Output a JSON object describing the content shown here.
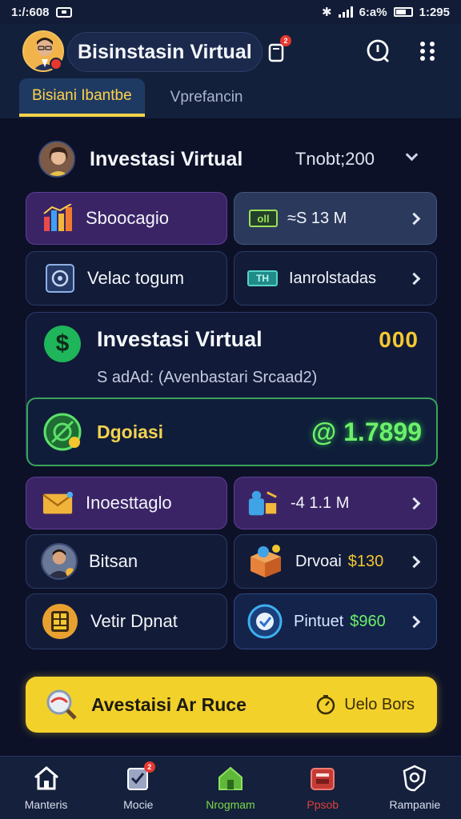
{
  "status_bar": {
    "time_left": "1:/:608",
    "battery_text": "6:a%",
    "time_right": "1:295"
  },
  "header": {
    "title": "Bisinstasin Virtual",
    "notification_count": "2",
    "tabs": [
      {
        "label": "Bisiani Ibantbe",
        "active": true
      },
      {
        "label": "Vprefancin",
        "active": false
      }
    ]
  },
  "profile": {
    "name": "Investasi Virtual",
    "total": "Tnobt;200"
  },
  "grid_top": [
    {
      "label": "Sboocagio",
      "icon": "chart-store-icon",
      "style": "purple"
    },
    {
      "label": "≈S   13 M",
      "badge": "oll",
      "icon": "cash-icon",
      "style": "slate"
    },
    {
      "label": "Velac togum",
      "icon": "gear-box-icon",
      "style": "dark"
    },
    {
      "label": "Ianrolstadas",
      "badge": "TH",
      "icon": "money-icon",
      "style": "dark"
    }
  ],
  "feature": {
    "title": "Investasi Virtual",
    "badge": "000",
    "subtitle": "S adAd: (Avenbastari Srcaad2)",
    "inner_label": "Dgoiasi",
    "amount": "@ 1.7899"
  },
  "grid_bottom": [
    {
      "label": "Inoesttaglo",
      "icon": "envelope-icon",
      "style": "purple"
    },
    {
      "label": "-4   1.1 M",
      "icon": "user-box-icon",
      "style": "purple"
    },
    {
      "label": "Bitsan",
      "icon": "avatar-icon",
      "style": "dark"
    },
    {
      "label": "Drvoai",
      "value": "$130",
      "icon": "box-coin-icon",
      "style": "dark"
    },
    {
      "label": "Vetir Dpnat",
      "icon": "grid-coin-icon",
      "style": "dark"
    },
    {
      "label": "Pintuet",
      "value": "$960",
      "icon": "target-icon",
      "style": "blue"
    }
  ],
  "cta": {
    "label": "Avestaisi Ar Ruce",
    "right_label": "Uelo Bors"
  },
  "bottom_nav": [
    {
      "label": "Manteris",
      "icon": "home-icon",
      "color": "#ffffff"
    },
    {
      "label": "Mocie",
      "icon": "checklist-icon",
      "color": "#ffffff",
      "badge": "2"
    },
    {
      "label": "Nrogmam",
      "icon": "house-green-icon",
      "color": "#7bd94a"
    },
    {
      "label": "Ppsob",
      "icon": "wallet-icon",
      "color": "#e0413a"
    },
    {
      "label": "Rampanie",
      "icon": "shield-gear-icon",
      "color": "#ffffff"
    }
  ],
  "colors": {
    "accent_yellow": "#ffd24a",
    "accent_green": "#6df06a",
    "cta_yellow": "#f3d12b",
    "background": "#0b0f26"
  }
}
